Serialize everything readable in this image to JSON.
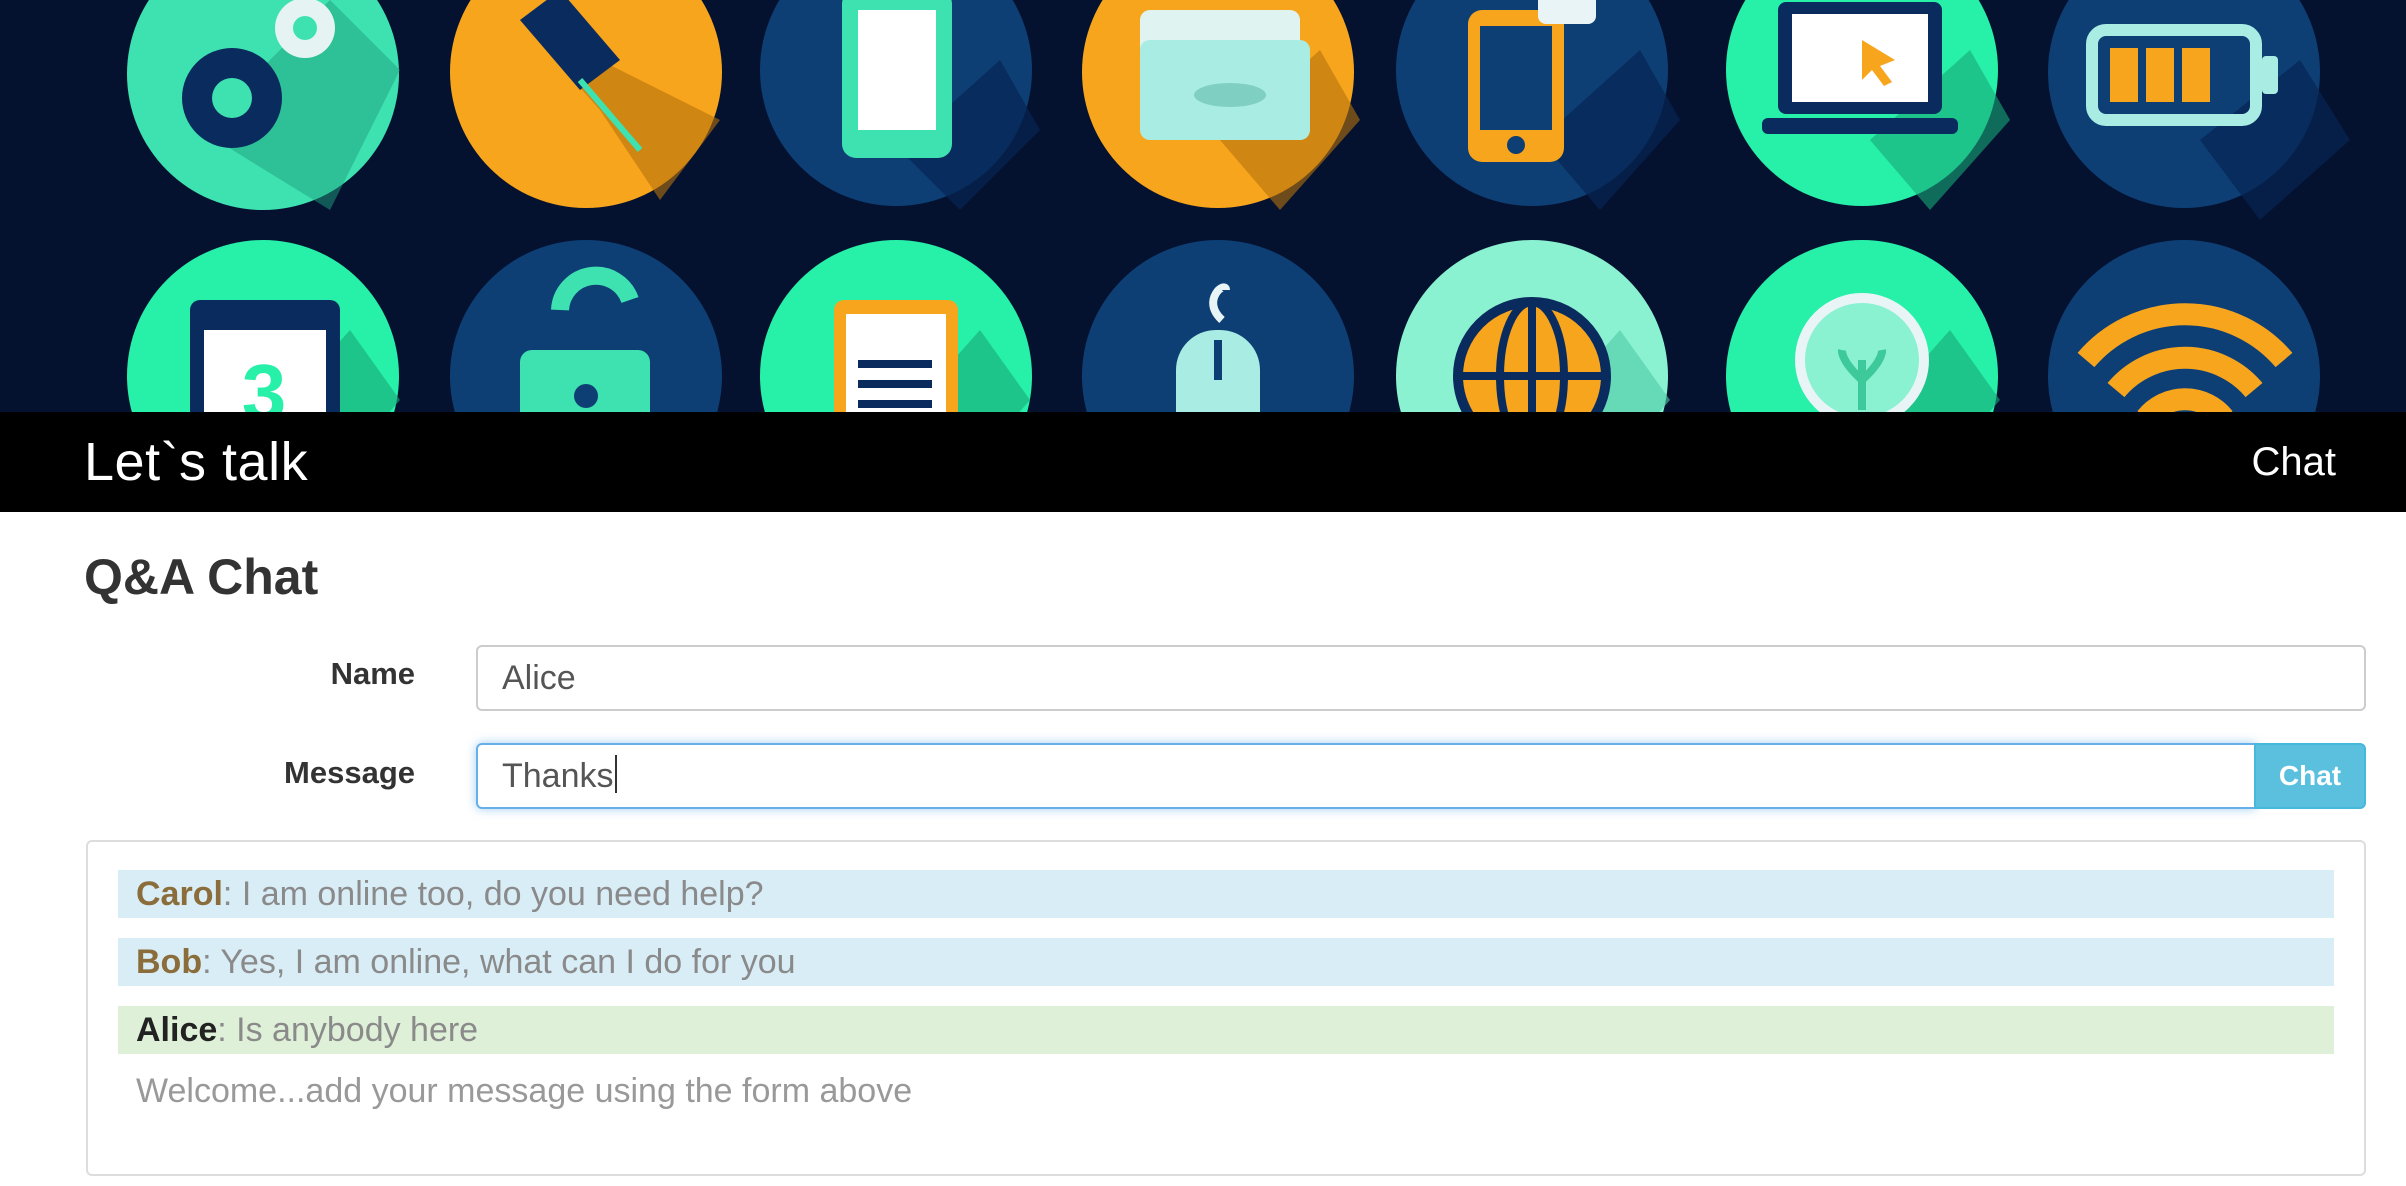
{
  "navbar": {
    "brand": "Let`s talk",
    "link": "Chat"
  },
  "page": {
    "title": "Q&A Chat"
  },
  "form": {
    "name_label": "Name",
    "name_value": "Alice",
    "message_label": "Message",
    "message_value": "Thanks",
    "submit_label": "Chat"
  },
  "messages": [
    {
      "author": "Carol",
      "text": ": I am online too, do you need help?"
    },
    {
      "author": "Bob",
      "text": ": Yes, I am online, what can I do for you"
    },
    {
      "author": "Alice",
      "text": ": Is anybody here"
    }
  ],
  "welcome": "Welcome...add your message using the form above",
  "colors": {
    "banner_bg": "#041230",
    "mint": "#27f0a8",
    "orange": "#f7a51d",
    "navy_circle": "#0d3f75",
    "button": "#5bc0de"
  },
  "banner_icons": [
    "gear-icon",
    "pushpin-icon",
    "smartphone-icon",
    "folder-icon",
    "phone-message-icon",
    "laptop-icon",
    "battery-icon",
    "calendar-icon",
    "unlock-icon",
    "document-icon",
    "mouse-icon",
    "globe-icon",
    "lightbulb-icon",
    "wifi-icon"
  ]
}
